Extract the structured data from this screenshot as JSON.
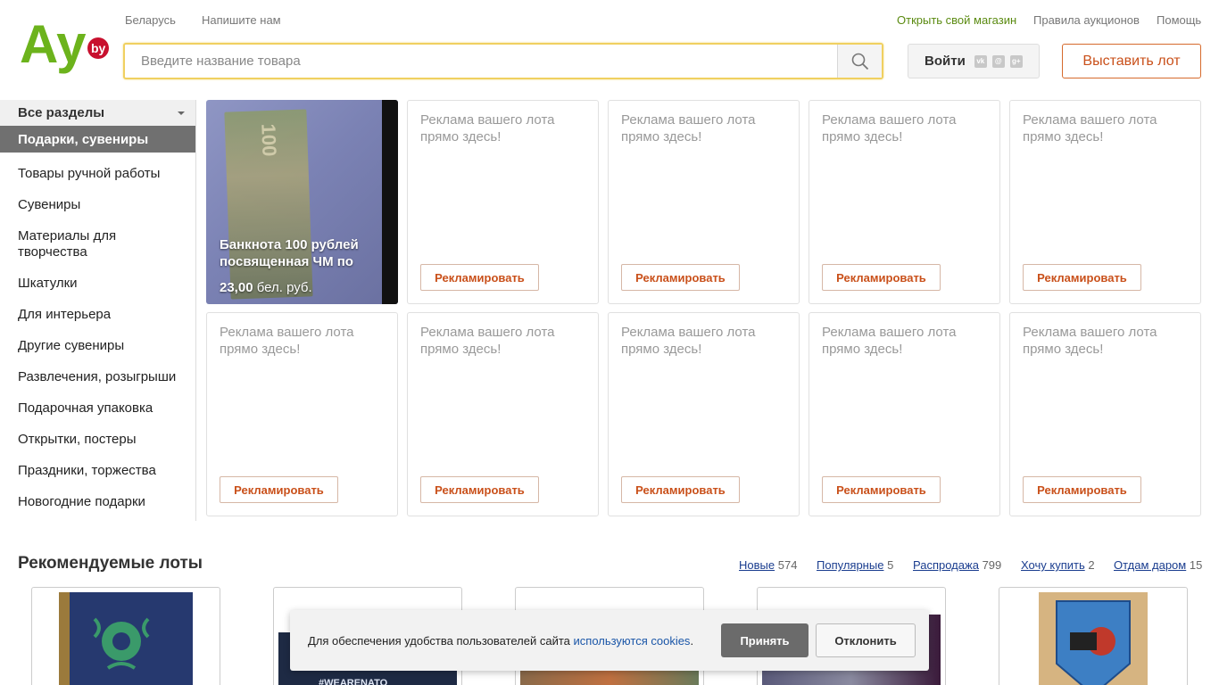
{
  "header": {
    "logo_text": "Ay",
    "logo_badge": "by",
    "country_link": "Беларусь",
    "contact_link": "Напишите нам",
    "open_shop_link": "Открыть свой магазин",
    "rules_link": "Правила аукционов",
    "help_link": "Помощь",
    "search_placeholder": "Введите название товара",
    "login_label": "Войти",
    "social_icons": [
      "vk-icon",
      "odnoklassniki-icon",
      "mail-icon",
      "google-plus-icon"
    ],
    "sell_button": "Выставить лот"
  },
  "sidebar": {
    "all_sections": "Все разделы",
    "active_section": "Подарки, сувениры",
    "items": [
      "Товары ручной работы",
      "Сувениры",
      "Материалы для творчества",
      "Шкатулки",
      "Для интерьера",
      "Другие сувениры",
      "Развлечения, розыгрыши",
      "Подарочная упаковка",
      "Открытки, постеры",
      "Праздники, торжества",
      "Новогодние подарки"
    ]
  },
  "featured_lot": {
    "title": "Банкнота 100 рублей посвященная ЧМ по",
    "price_value": "23,00",
    "price_currency": "бел. руб."
  },
  "ad_tiles": {
    "text": "Реклама вашего лота прямо здесь!",
    "button": "Рекламировать",
    "count": 9
  },
  "recommended": {
    "title": "Рекомендуемые лоты",
    "tabs": [
      {
        "label": "Новые",
        "count": "574"
      },
      {
        "label": "Популярные",
        "count": "5"
      },
      {
        "label": "Распродажа",
        "count": "799"
      },
      {
        "label": "Хочу купить",
        "count": "2"
      },
      {
        "label": "Отдам даром",
        "count": "15"
      }
    ],
    "lot_overlay_text": "#WEARENATO"
  },
  "cookie_bar": {
    "text_before": "Для обеспечения удобства пользователей сайта ",
    "link_text": "используются cookies",
    "text_after": ".",
    "accept": "Принять",
    "decline": "Отклонить"
  },
  "colors": {
    "brand_green": "#6cb31c",
    "brand_red": "#c8102e",
    "accent_orange": "#c9501a",
    "active_section_bg": "#707070"
  }
}
